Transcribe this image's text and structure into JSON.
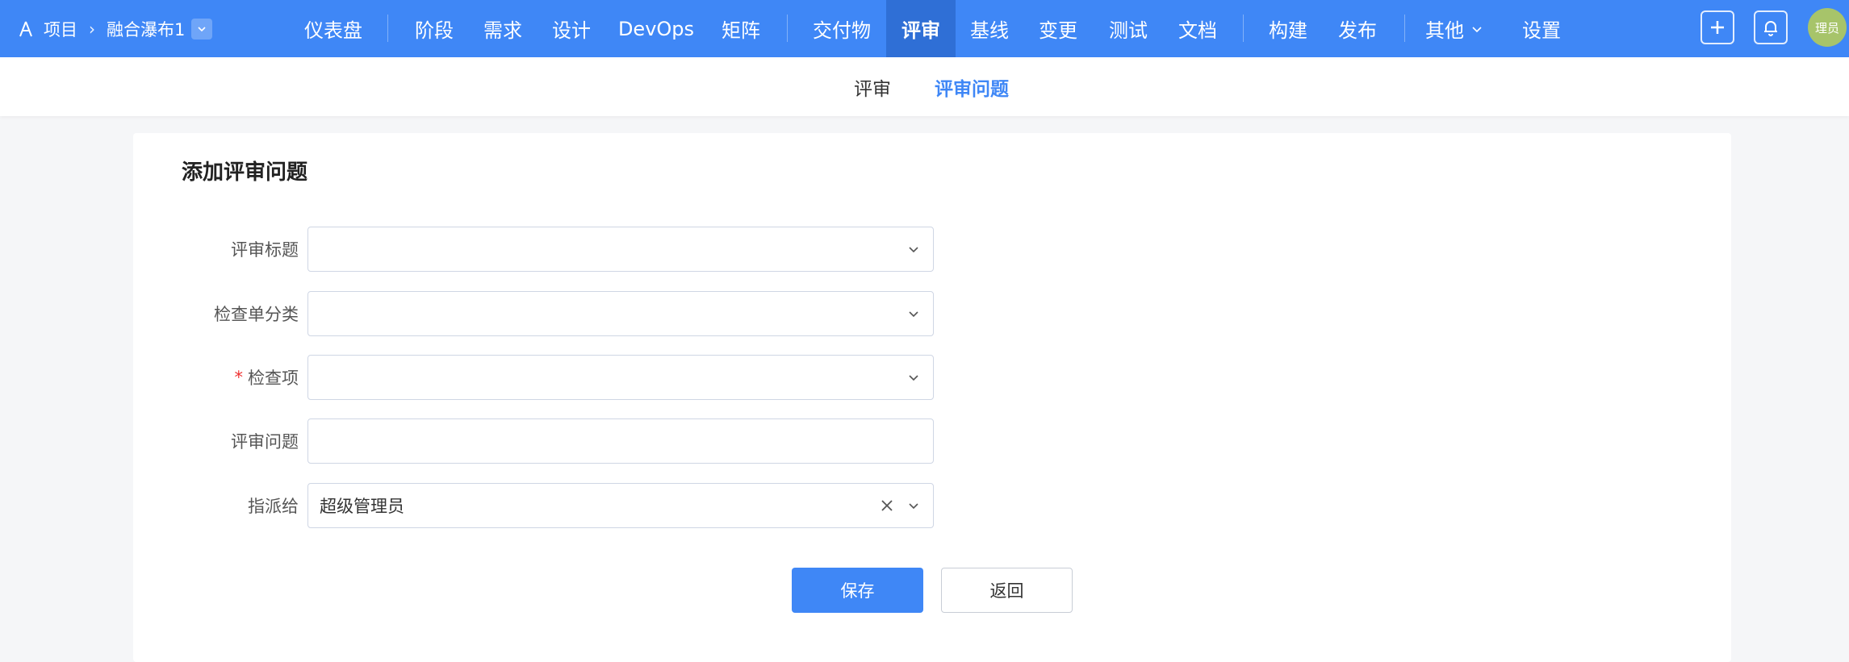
{
  "header": {
    "breadcrumb_root": "项目",
    "project_name": "融合瀑布1",
    "nav": [
      {
        "label": "仪表盘"
      },
      {
        "label": "阶段"
      },
      {
        "label": "需求"
      },
      {
        "label": "设计"
      },
      {
        "label": "DevOps"
      },
      {
        "label": "矩阵"
      },
      {
        "label": "交付物"
      },
      {
        "label": "评审"
      },
      {
        "label": "基线"
      },
      {
        "label": "变更"
      },
      {
        "label": "测试"
      },
      {
        "label": "文档"
      },
      {
        "label": "构建"
      },
      {
        "label": "发布"
      },
      {
        "label": "其他"
      },
      {
        "label": "设置"
      }
    ],
    "active_nav": "评审",
    "avatar_text": "理员",
    "accent": "#3f87f6"
  },
  "subtabs": [
    {
      "label": "评审"
    },
    {
      "label": "评审问题"
    }
  ],
  "form": {
    "title": "添加评审问题",
    "fields": [
      {
        "label": "评审标题",
        "value": "",
        "required": false
      },
      {
        "label": "检查单分类",
        "value": "",
        "required": false
      },
      {
        "label": "检查项",
        "value": "",
        "required": true
      },
      {
        "label": "评审问题",
        "value": "",
        "required": false
      },
      {
        "label": "指派给",
        "value": "超级管理员",
        "required": false
      }
    ],
    "save_label": "保存",
    "back_label": "返回"
  }
}
